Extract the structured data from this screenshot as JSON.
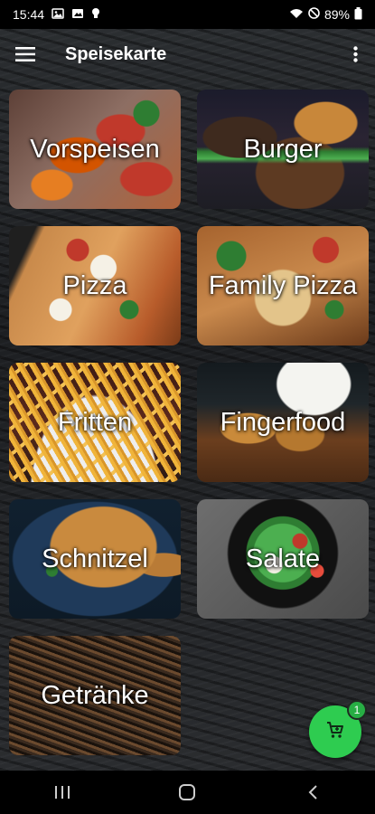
{
  "status_bar": {
    "time": "15:44",
    "battery": "89%",
    "icons_left": [
      "gallery-icon",
      "image-icon",
      "bulb-icon"
    ],
    "icons_right": [
      "wifi-icon",
      "do-not-disturb-icon",
      "battery-icon"
    ]
  },
  "app_bar": {
    "title": "Speisekarte",
    "menu_icon": "hamburger-menu-icon",
    "more_icon": "more-vert-icon"
  },
  "categories": [
    {
      "label": "Vorspeisen"
    },
    {
      "label": "Burger"
    },
    {
      "label": "Pizza"
    },
    {
      "label": "Family Pizza"
    },
    {
      "label": "Fritten"
    },
    {
      "label": "Fingerfood"
    },
    {
      "label": "Schnitzel"
    },
    {
      "label": "Salate"
    },
    {
      "label": "Getränke"
    }
  ],
  "cart": {
    "icon": "cart-icon",
    "count": "1",
    "color": "#2ecc50"
  },
  "nav_bar": {
    "icons": [
      "recent-apps-icon",
      "home-icon",
      "back-icon"
    ]
  }
}
